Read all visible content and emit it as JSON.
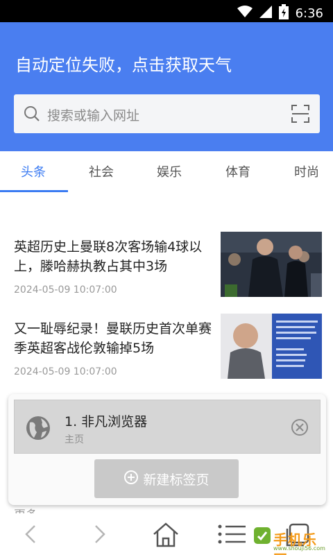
{
  "status_bar": {
    "time": "6:36"
  },
  "header": {
    "weather": "自动定位失败，点击获取天气",
    "search_placeholder": "搜索或输入网址",
    "accent_color": "#4a7ef0"
  },
  "tabs": [
    {
      "label": "头条",
      "active": true
    },
    {
      "label": "社会",
      "active": false
    },
    {
      "label": "娱乐",
      "active": false
    },
    {
      "label": "体育",
      "active": false
    },
    {
      "label": "时尚",
      "active": false
    }
  ],
  "news": [
    {
      "title": "英超历史上曼联8次客场输4球以上，滕哈赫执教占其中3场",
      "time": "2024-05-09 10:07:00"
    },
    {
      "title": "又一耻辱纪录！曼联历史首次单赛季英超客战伦敦输掉5场",
      "time": "2024-05-09 10:07:00"
    }
  ],
  "tab_switcher": {
    "entry_title": "1. 非凡浏览器",
    "entry_subtitle": "主页",
    "new_tab_label": "新建标签页"
  },
  "peek_text": "更多  ...",
  "watermark": {
    "text": "手机乐园",
    "url": "www.shouji56.com"
  }
}
